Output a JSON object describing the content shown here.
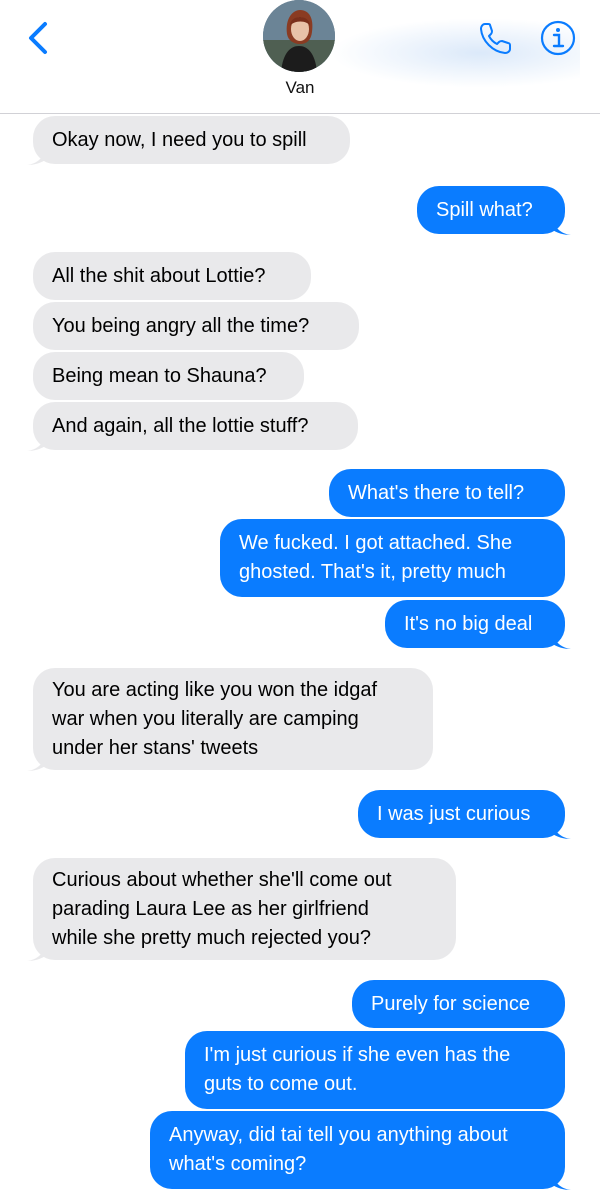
{
  "header": {
    "contact_name": "Van",
    "icons": {
      "back": "chevron-left-icon",
      "phone": "phone-icon",
      "info": "info-icon"
    },
    "accent_color": "#0a7cff"
  },
  "messages": [
    {
      "from": "them",
      "text": "Okay now, I need you to spill"
    },
    {
      "from": "me",
      "text": "Spill what?"
    },
    {
      "from": "them",
      "text": "All the shit about Lottie?"
    },
    {
      "from": "them",
      "text": "You being angry all the time?"
    },
    {
      "from": "them",
      "text": "Being mean to Shauna?"
    },
    {
      "from": "them",
      "text": "And again, all the lottie stuff?"
    },
    {
      "from": "me",
      "text": "What's there to tell?"
    },
    {
      "from": "me",
      "text": "We fucked. I got attached. She\nghosted. That's it, pretty much"
    },
    {
      "from": "me",
      "text": "It's no big deal"
    },
    {
      "from": "them",
      "text": "You are acting like you won the idgaf\nwar when you literally are camping\nunder her stans' tweets"
    },
    {
      "from": "me",
      "text": "I was just curious"
    },
    {
      "from": "them",
      "text": "Curious about whether she'll come out\nparading Laura Lee as her girlfriend\nwhile she pretty much rejected you?"
    },
    {
      "from": "me",
      "text": "Purely for science"
    },
    {
      "from": "me",
      "text": "I'm just curious if she even has the\nguts to come out."
    },
    {
      "from": "me",
      "text": "Anyway, did tai tell you anything about\nwhat's coming?"
    }
  ]
}
